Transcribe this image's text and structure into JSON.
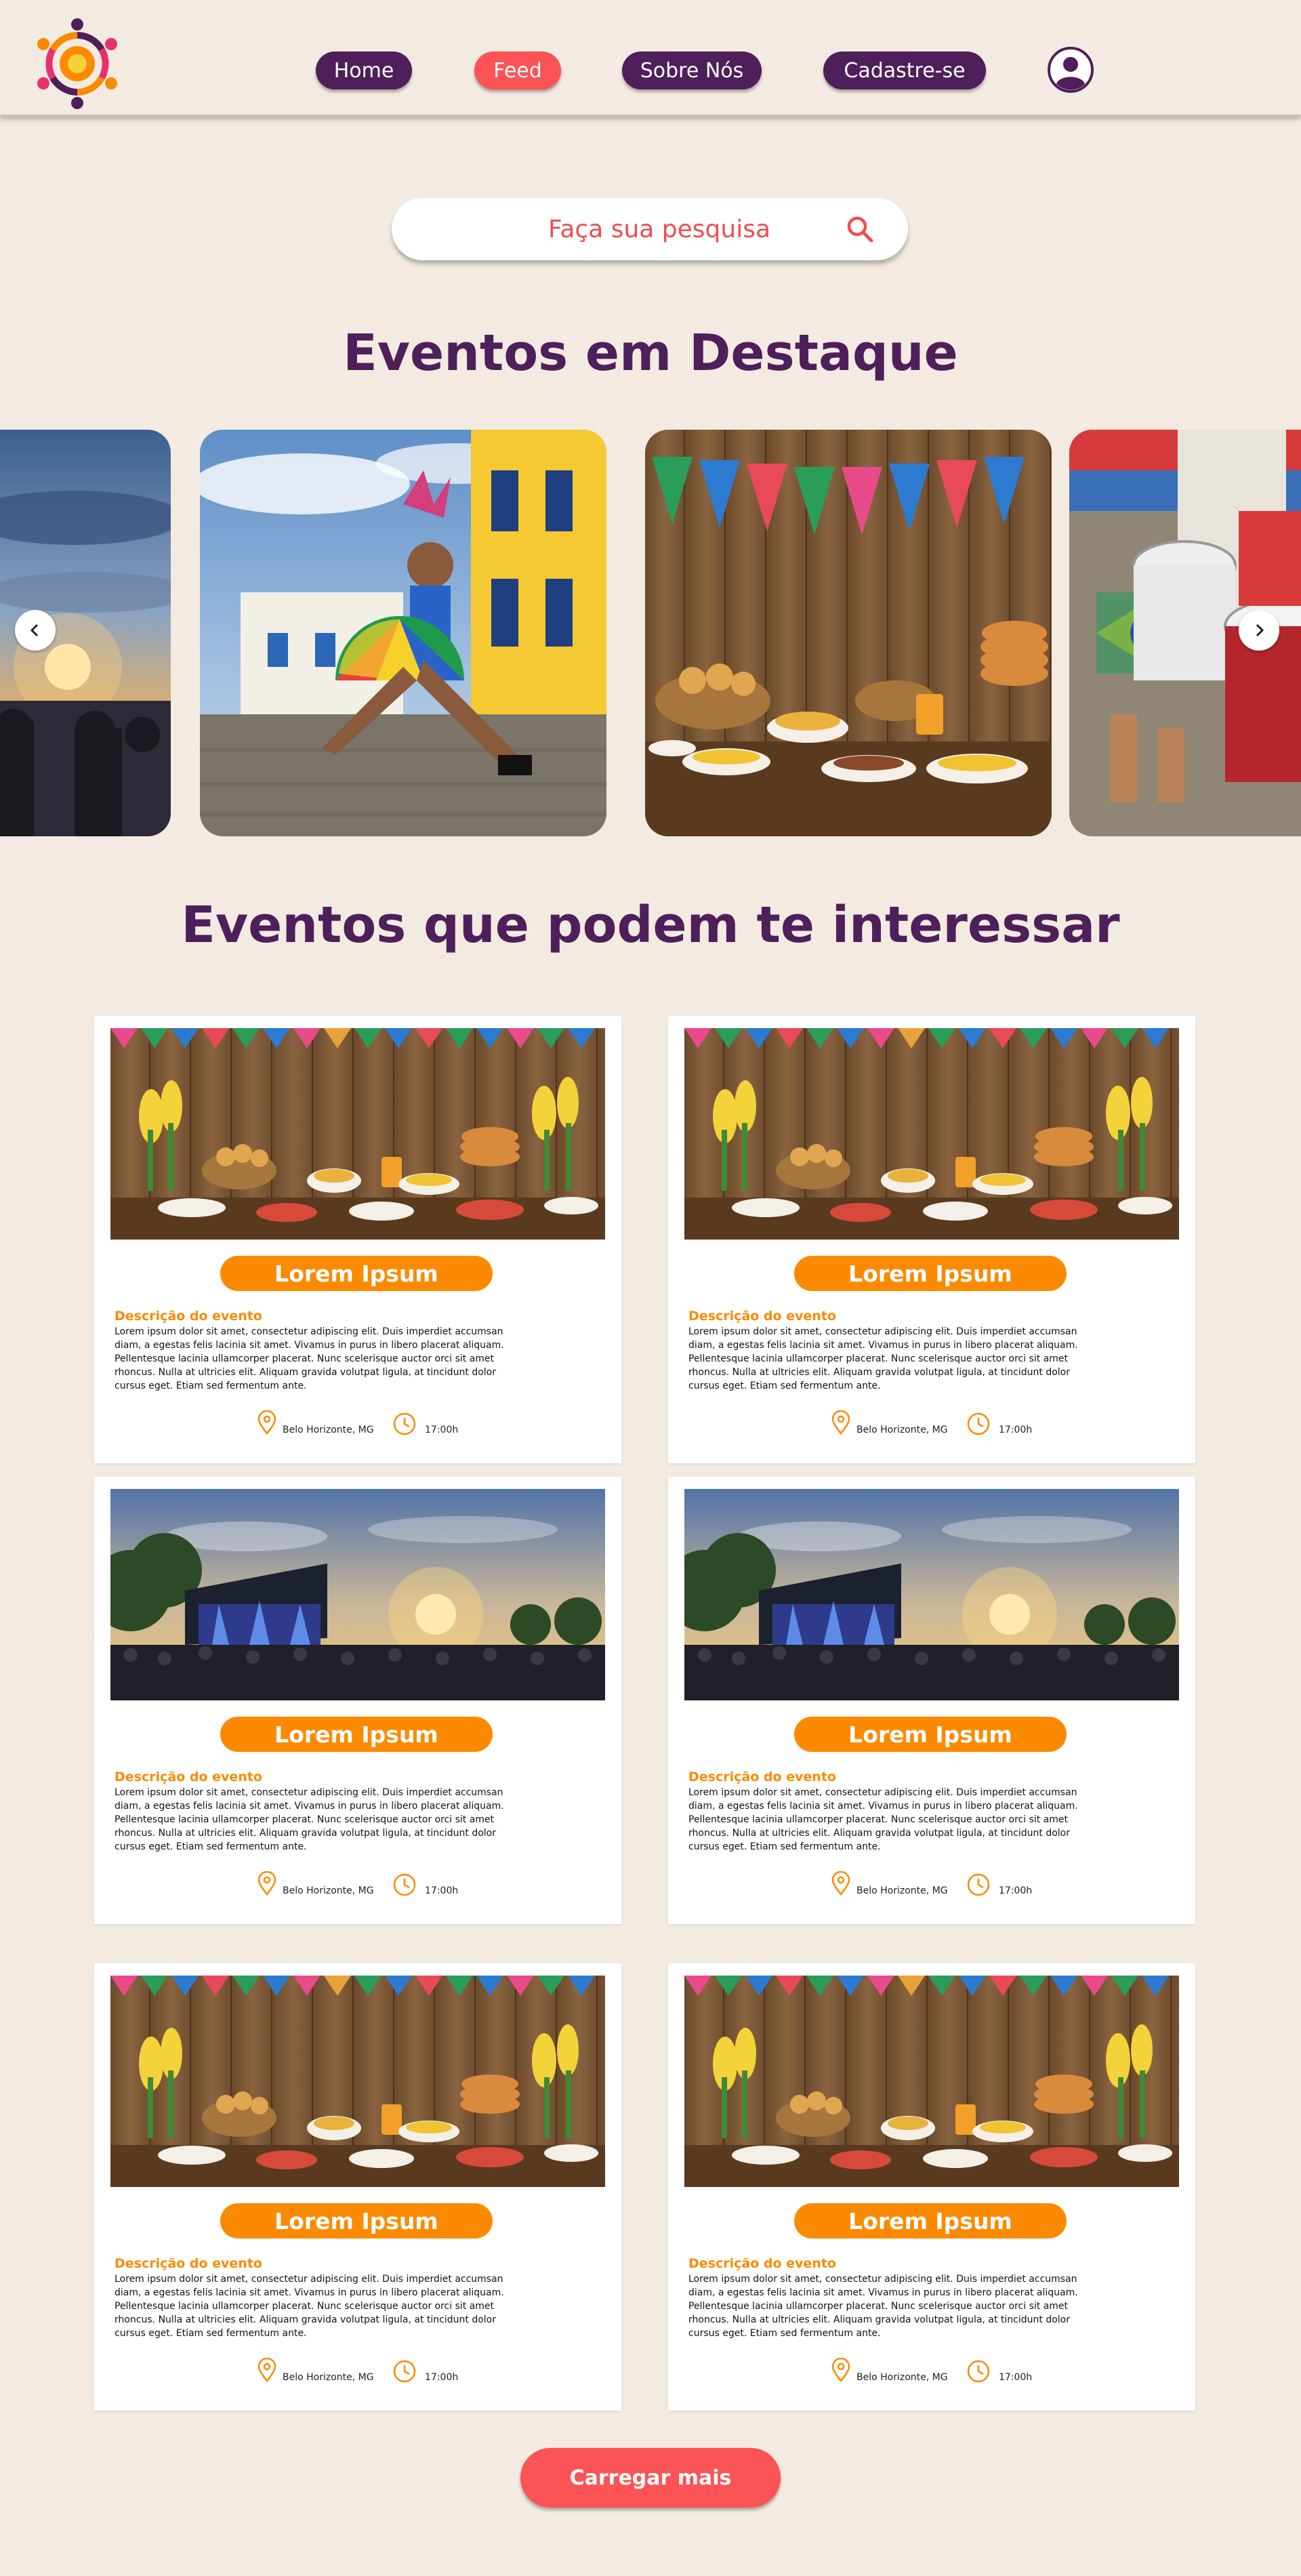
{
  "brand": {
    "logo_icon": "mandala-people-icon",
    "colors": {
      "primary": "#4e1f5a",
      "accent": "#fb5356",
      "orange": "#fb8a00",
      "background": "#f3ebe1"
    }
  },
  "nav": {
    "items": [
      {
        "label": "Home",
        "active": false
      },
      {
        "label": "Feed",
        "active": true
      },
      {
        "label": "Sobre Nós",
        "active": false
      },
      {
        "label": "Cadastre-se",
        "active": false
      }
    ],
    "profile_icon": "user-circle-icon"
  },
  "search": {
    "placeholder": "Faça sua pesquisa",
    "icon": "search-icon"
  },
  "featured": {
    "title": "Eventos em Destaque",
    "slides": [
      "sunset-crowd-photo",
      "frevo-dancer-photo",
      "festa-junina-table-photo",
      "drummers-photo"
    ],
    "prev_icon": "chevron-left-icon",
    "next_icon": "chevron-right-icon"
  },
  "interest": {
    "title": "Eventos que podem te interessar",
    "cards": [
      {
        "name": "Lorem Ipsum",
        "image": "festa-junina-table-photo",
        "desc_title": "Descrição do evento",
        "desc": "Lorem ipsum dolor sit amet, consectetur adipiscing elit. Duis imperdiet accumsan diam, a egestas felis lacinia sit amet. Vivamus in purus in libero placerat aliquam. Pellentesque lacinia ullamcorper placerat. Nunc scelerisque auctor orci sit amet rhoncus. Nulla at ultricies elit. Aliquam gravida volutpat ligula, at tincidunt dolor cursus eget. Etiam sed fermentum ante.",
        "location": "Belo Horizonte, MG",
        "time": "17:00h"
      },
      {
        "name": "Lorem Ipsum",
        "image": "festa-junina-table-photo",
        "desc_title": "Descrição do evento",
        "desc": "Lorem ipsum dolor sit amet, consectetur adipiscing elit. Duis imperdiet accumsan diam, a egestas felis lacinia sit amet. Vivamus in purus in libero placerat aliquam. Pellentesque lacinia ullamcorper placerat. Nunc scelerisque auctor orci sit amet rhoncus. Nulla at ultricies elit. Aliquam gravida volutpat ligula, at tincidunt dolor cursus eget. Etiam sed fermentum ante.",
        "location": "Belo Horizonte, MG",
        "time": "17:00h"
      },
      {
        "name": "Lorem Ipsum",
        "image": "concert-sunset-photo",
        "desc_title": "Descrição do evento",
        "desc": "Lorem ipsum dolor sit amet, consectetur adipiscing elit. Duis imperdiet accumsan diam, a egestas felis lacinia sit amet. Vivamus in purus in libero placerat aliquam. Pellentesque lacinia ullamcorper placerat. Nunc scelerisque auctor orci sit amet rhoncus. Nulla at ultricies elit. Aliquam gravida volutpat ligula, at tincidunt dolor cursus eget. Etiam sed fermentum ante.",
        "location": "Belo Horizonte, MG",
        "time": "17:00h"
      },
      {
        "name": "Lorem Ipsum",
        "image": "concert-sunset-photo",
        "desc_title": "Descrição do evento",
        "desc": "Lorem ipsum dolor sit amet, consectetur adipiscing elit. Duis imperdiet accumsan diam, a egestas felis lacinia sit amet. Vivamus in purus in libero placerat aliquam. Pellentesque lacinia ullamcorper placerat. Nunc scelerisque auctor orci sit amet rhoncus. Nulla at ultricies elit. Aliquam gravida volutpat ligula, at tincidunt dolor cursus eget. Etiam sed fermentum ante.",
        "location": "Belo Horizonte, MG",
        "time": "17:00h"
      },
      {
        "name": "Lorem Ipsum",
        "image": "festa-junina-table-photo",
        "desc_title": "Descrição do evento",
        "desc": "Lorem ipsum dolor sit amet, consectetur adipiscing elit. Duis imperdiet accumsan diam, a egestas felis lacinia sit amet. Vivamus in purus in libero placerat aliquam. Pellentesque lacinia ullamcorper placerat. Nunc scelerisque auctor orci sit amet rhoncus. Nulla at ultricies elit. Aliquam gravida volutpat ligula, at tincidunt dolor cursus eget. Etiam sed fermentum ante.",
        "location": "Belo Horizonte, MG",
        "time": "17:00h"
      },
      {
        "name": "Lorem Ipsum",
        "image": "festa-junina-table-photo",
        "desc_title": "Descrição do evento",
        "desc": "Lorem ipsum dolor sit amet, consectetur adipiscing elit. Duis imperdiet accumsan diam, a egestas felis lacinia sit amet. Vivamus in purus in libero placerat aliquam. Pellentesque lacinia ullamcorper placerat. Nunc scelerisque auctor orci sit amet rhoncus. Nulla at ultricies elit. Aliquam gravida volutpat ligula, at tincidunt dolor cursus eget. Etiam sed fermentum ante.",
        "location": "Belo Horizonte, MG",
        "time": "17:00h"
      }
    ],
    "location_icon": "map-pin-icon",
    "time_icon": "clock-icon"
  },
  "load_more": {
    "label": "Carregar mais"
  }
}
